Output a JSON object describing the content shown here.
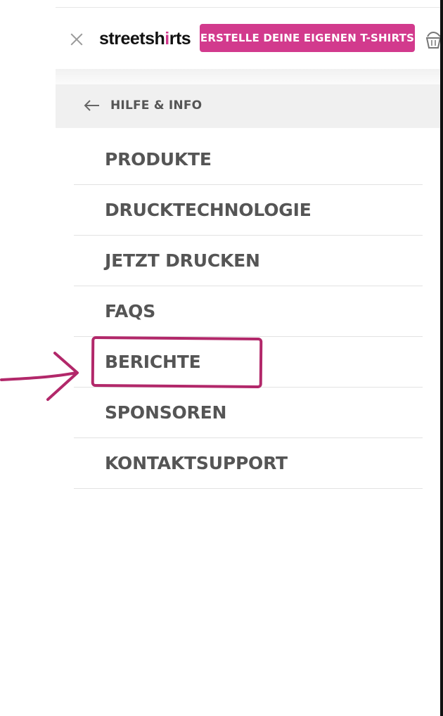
{
  "header": {
    "logo_text_before": "streetsh",
    "logo_mark": "i",
    "logo_text_after": "rts",
    "cta_label": "ERSTELLE DEINE EIGENEN T-SHIRTS"
  },
  "breadcrumb": {
    "label": "HILFE & INFO"
  },
  "menu": {
    "items": [
      {
        "label": "PRODUKTE"
      },
      {
        "label": "DRUCKTECHNOLOGIE"
      },
      {
        "label": "JETZT DRUCKEN"
      },
      {
        "label": "FAQS"
      },
      {
        "label": "BERICHTE",
        "highlighted": true
      },
      {
        "label": "SPONSOREN"
      },
      {
        "label": "KONTAKTSUPPORT"
      }
    ]
  },
  "colors": {
    "brand": "#d23a8d",
    "annotation": "#b2286a",
    "menu_text": "#555555",
    "breadcrumb_bg": "#f0f0f0"
  },
  "icons": {
    "close": "close-icon",
    "cart": "cart-icon",
    "back": "back-arrow-icon"
  }
}
